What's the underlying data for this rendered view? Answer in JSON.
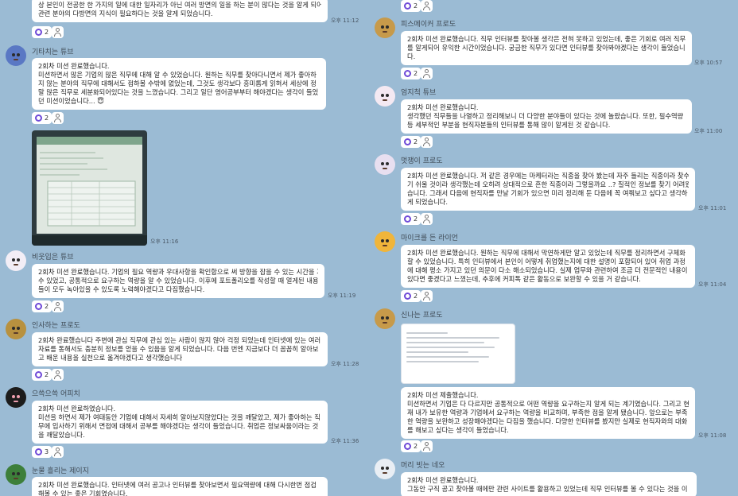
{
  "colors": {
    "background": "#9bbbd4",
    "bubble": "#ffffff",
    "reaction": "#6f4ad8"
  },
  "left": [
    {
      "name": "",
      "lines": [
        "상 본인이 전공한 한 가지의 일에 대한 일자리가 아닌 여러 방면의 일을 하는 분이 많다는 것을 알게 되어",
        "관련 분야의 다방면의 지식이 필요하다는 것을 알게 되었습니다."
      ],
      "time": "오후 11:12",
      "reactions": "2"
    },
    {
      "name": "기타치는 튜브",
      "lines": [
        "2회차 미션 완료했습니다.",
        "미션하면서 많은 기업의 많은 직무에 대해 알 수 있었습니다. 원하는 직무를 찾아다니면서 제가 좋아하",
        "지 않는 분야의 직무에 대해서도 접하볼 수밖에 없었는데, 그것도 생각보다 흥미롭게 읽혀서 세상에 정",
        "말 많은 직무로 세분화되어있다는 것을 느꼈습니다. 그리고 일단 영어공부부터 해야겠다는 생각이 들었",
        "던 미션이었습니다... 😇"
      ],
      "time": "",
      "reactions": "2"
    },
    {
      "photo": true,
      "time": "오후 11:16"
    },
    {
      "name": "비웃입은 튜브",
      "lines": [
        "2회차 미션 완료했습니다. 기업의 필요 역량과 우대사항을 확인함으로 써 방향을 잡을 수 있는 시간을 가질",
        "수 있었고, 공통적으로 요구하는 역량을 알 수 있었습니다. 이후에 포트폴리오를 작성할 때 얼게된 내용",
        "들이 모두 녹아있을 수 있도록 노력해야겠다고 다짐했습니다."
      ],
      "time": "오후 11:19",
      "reactions": "2"
    },
    {
      "name": "인사하는 프로도",
      "lines": [
        "2회차 완료했습니다 주변에 관심 직무에 관심 있는 사람이 많지 않아 걱정 되었는데 인터넷에 있는 여러",
        "자료를 통해서도 충분히 정보를 얻을 수 있음을 알게 되었습니다. 다음 번엔 지금보다 더 꼼꼼히 알아보",
        "고 배운 내용을 실천으로 옮겨야겠다고 생각했습니다"
      ],
      "time": "오후 11:28",
      "reactions": "2"
    },
    {
      "name": "으쓱으쓱 어피치",
      "lines": [
        "2회차 미션 완료하였습니다.",
        "미션을 하면서 제가 여태동안 기업에 대해서 자세히 알아보지않았다는 것을 깨달았고, 제가 좋아하는 직",
        "무에 입사하기 위해서 면접에 대해서 공부를 해야겠다는 생각이 들었습니다. 취업은 정보싸움이라는 것",
        "을 깨달았습니다."
      ],
      "time": "오후 11:36",
      "reactions": "3"
    },
    {
      "name": "눈물 흘리는 제이지",
      "lines": [
        "2회차 미션 완료했습니다. 인터넷에 여러 공고나 인터뷰를 찾아보면서 필요역량에 대해 다시한번 점검",
        "해볼 수 있는 좋은 기회였습니다."
      ],
      "time": "",
      "reactions": ""
    }
  ],
  "right": [
    {
      "name": "",
      "lines": [],
      "time": "",
      "reactions": "2"
    },
    {
      "name": "피스메이커 프로도",
      "lines": [
        "2회차 미션 완료했습니다. 직무 인터뷰를 찾아볼 생각은 전혀 못하고 있었는데, 좋은 기회로 여러 직무",
        "를 알게되어 유익한 시간이었습니다. 궁금한 직무가 있다면 인터뷰를 찾아봐야겠다는 생각이 들었습니",
        "다."
      ],
      "time": "오후 10:57",
      "reactions": "2"
    },
    {
      "name": "엄지척 튜브",
      "lines": [
        "2회차 미션 완료했습니다.",
        "생각했던 직무들을 나열하고 정리해보니 더 다양한 분야들이 있다는 것에 놀랐습니다. 또한, 필수역량",
        "등 세부적인 부분을 현직자분들의 인터뷰를 통해 많이 알게된 것 같습니다."
      ],
      "time": "오후 11:00",
      "reactions": "2"
    },
    {
      "name": "멋쟁이 프로도",
      "lines": [
        "2회차 미션 완료했습니다. 저 같은 경우에는 마케터라는 직종을 찾아 봤는데 자주 들리는 직종이라 찾수",
        "기 쉬울 것이라 생각했는데 오히려 상대적으로 흔한 직종이라 그렇을까요 ..? 질적인 정보를 찾기 어려웠",
        "습니다. 그래서 다음에 현직자를 만날 기회가 있으면 미리 정리해 둔 다음에 꼭 여쭤보고 싶다고 생각하",
        "게 되었습니다."
      ],
      "time": "오후 11:01",
      "reactions": "2"
    },
    {
      "name": "마이크를 든 라이언",
      "lines": [
        "2회차 미션 완료했습니다. 원하는 직무에 대해서 막연하게만 알고 있었는데 직무를 정리하면서 구체화",
        "할 수 있었습니다. 특히 인터뷰에서 본인이 어떻게 취업했는지에 대한 설명이 포함되어 있어 취업 과정",
        "에 대해 평소 가지고 있던 의문이 다소 해소되었습니다. 실제 업무와 관련하여 조금 더 전문적인 내용이",
        "있다면 좋겠다고 느꼈는데, 추후에 커피톡 같은 활동으로 보완할 수 있을 거 같습니다."
      ],
      "time": "오후 11:04",
      "reactions": "2"
    },
    {
      "name": "신나는 프로도",
      "doc": true
    },
    {
      "name": "",
      "lines": [
        "2회차 미션 제출했습니다.",
        "미션하면서 기업은 다 다르지만 공통적으로 어떤 역량을 요구하는지 알게 되는 계기였습니다. 그리고 현",
        "재 내가 보유한 역량과 기업에서 요구하는 역량을 비교하며, 부족한 점을 알게 됐습니다. 앞으로는 부족",
        "한 역량을 보완하고 성장해야겠다는 다짐을 했습니다. 다양한 인터뷰를 봤지만 실제로 현직자와의 대화",
        "를 해보고 싶다는 생각이 들었습니다."
      ],
      "time": "오후 11:08",
      "reactions": "2"
    },
    {
      "name": "머리 빗는 네오",
      "lines": [
        "2회차 미션 완료했습니다.",
        "그동안 구직 공고 찾아볼 때에만 관련 사이트를 활용하고 있었는데 직무 인터뷰를 볼 수 있다는 것을 이"
      ],
      "time": "",
      "reactions": ""
    }
  ]
}
